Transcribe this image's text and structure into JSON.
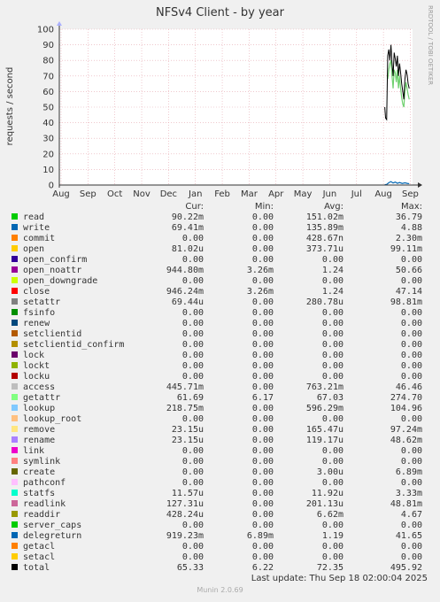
{
  "chart_data": {
    "type": "line",
    "title": "NFSv4 Client - by year",
    "ylabel": "requests / second",
    "side_label": "RRDTOOL / TOBI OETIKER",
    "ylim": [
      0,
      100
    ],
    "yticks": [
      0,
      10,
      20,
      30,
      40,
      50,
      60,
      70,
      80,
      90,
      100
    ],
    "x_categories": [
      "Aug",
      "Sep",
      "Oct",
      "Nov",
      "Dec",
      "Jan",
      "Feb",
      "Mar",
      "Apr",
      "May",
      "Jun",
      "Jul",
      "Aug",
      "Sep"
    ],
    "grid": true,
    "series_plot": [
      {
        "name": "total",
        "color": "#000000",
        "points": [
          [
            12.05,
            50
          ],
          [
            12.08,
            43
          ],
          [
            12.12,
            42
          ],
          [
            12.16,
            83
          ],
          [
            12.2,
            87
          ],
          [
            12.24,
            80
          ],
          [
            12.28,
            90
          ],
          [
            12.32,
            78
          ],
          [
            12.36,
            70
          ],
          [
            12.4,
            85
          ],
          [
            12.44,
            81
          ],
          [
            12.48,
            76
          ],
          [
            12.52,
            83
          ],
          [
            12.56,
            70
          ],
          [
            12.6,
            78
          ],
          [
            12.64,
            72
          ],
          [
            12.68,
            65
          ],
          [
            12.72,
            60
          ],
          [
            12.76,
            55
          ],
          [
            12.8,
            68
          ],
          [
            12.84,
            74
          ],
          [
            12.88,
            71
          ],
          [
            12.92,
            65
          ],
          [
            12.96,
            62
          ]
        ]
      },
      {
        "name": "access",
        "color": "#6fd06f",
        "points": [
          [
            12.16,
            68
          ],
          [
            12.2,
            74
          ],
          [
            12.24,
            78
          ],
          [
            12.28,
            80
          ],
          [
            12.32,
            70
          ],
          [
            12.36,
            62
          ],
          [
            12.4,
            74
          ],
          [
            12.44,
            72
          ],
          [
            12.48,
            66
          ],
          [
            12.52,
            74
          ],
          [
            12.56,
            62
          ],
          [
            12.6,
            70
          ],
          [
            12.64,
            62
          ],
          [
            12.68,
            56
          ],
          [
            12.72,
            52
          ],
          [
            12.76,
            50
          ],
          [
            12.8,
            60
          ],
          [
            12.84,
            66
          ],
          [
            12.88,
            62
          ],
          [
            12.92,
            58
          ],
          [
            12.96,
            55
          ]
        ]
      },
      {
        "name": "write",
        "color": "#0066b3",
        "points": [
          [
            12.05,
            0.2
          ],
          [
            12.12,
            0.4
          ],
          [
            12.2,
            1.5
          ],
          [
            12.28,
            2.2
          ],
          [
            12.36,
            1.3
          ],
          [
            12.44,
            1.9
          ],
          [
            12.52,
            1.1
          ],
          [
            12.6,
            1.6
          ],
          [
            12.7,
            1.0
          ],
          [
            12.8,
            1.4
          ],
          [
            12.9,
            1.0
          ],
          [
            12.96,
            0.9
          ]
        ]
      }
    ],
    "columns": [
      "Cur:",
      "Min:",
      "Avg:",
      "Max:"
    ],
    "series": [
      {
        "name": "read",
        "color": "#00cc00",
        "cur": "90.22m",
        "min": "0.00",
        "avg": "151.02m",
        "max": "36.79"
      },
      {
        "name": "write",
        "color": "#0066b3",
        "cur": "69.41m",
        "min": "0.00",
        "avg": "135.89m",
        "max": "4.88"
      },
      {
        "name": "commit",
        "color": "#ff8000",
        "cur": "0.00",
        "min": "0.00",
        "avg": "428.67n",
        "max": "2.30m"
      },
      {
        "name": "open",
        "color": "#ffcc00",
        "cur": "81.02u",
        "min": "0.00",
        "avg": "373.71u",
        "max": "99.11m"
      },
      {
        "name": "open_confirm",
        "color": "#330099",
        "cur": "0.00",
        "min": "0.00",
        "avg": "0.00",
        "max": "0.00"
      },
      {
        "name": "open_noattr",
        "color": "#990099",
        "cur": "944.80m",
        "min": "3.26m",
        "avg": "1.24",
        "max": "50.66"
      },
      {
        "name": "open_downgrade",
        "color": "#ccff00",
        "cur": "0.00",
        "min": "0.00",
        "avg": "0.00",
        "max": "0.00"
      },
      {
        "name": "close",
        "color": "#ff0000",
        "cur": "946.24m",
        "min": "3.26m",
        "avg": "1.24",
        "max": "47.14"
      },
      {
        "name": "setattr",
        "color": "#808080",
        "cur": "69.44u",
        "min": "0.00",
        "avg": "280.78u",
        "max": "98.81m"
      },
      {
        "name": "fsinfo",
        "color": "#008f00",
        "cur": "0.00",
        "min": "0.00",
        "avg": "0.00",
        "max": "0.00"
      },
      {
        "name": "renew",
        "color": "#00487d",
        "cur": "0.00",
        "min": "0.00",
        "avg": "0.00",
        "max": "0.00"
      },
      {
        "name": "setclientid",
        "color": "#b35a00",
        "cur": "0.00",
        "min": "0.00",
        "avg": "0.00",
        "max": "0.00"
      },
      {
        "name": "setclientid_confirm",
        "color": "#b38f00",
        "cur": "0.00",
        "min": "0.00",
        "avg": "0.00",
        "max": "0.00"
      },
      {
        "name": "lock",
        "color": "#6b006b",
        "cur": "0.00",
        "min": "0.00",
        "avg": "0.00",
        "max": "0.00"
      },
      {
        "name": "lockt",
        "color": "#8fb300",
        "cur": "0.00",
        "min": "0.00",
        "avg": "0.00",
        "max": "0.00"
      },
      {
        "name": "locku",
        "color": "#b30000",
        "cur": "0.00",
        "min": "0.00",
        "avg": "0.00",
        "max": "0.00"
      },
      {
        "name": "access",
        "color": "#bebebe",
        "cur": "445.71m",
        "min": "0.00",
        "avg": "763.21m",
        "max": "46.46"
      },
      {
        "name": "getattr",
        "color": "#80ff80",
        "cur": "61.69",
        "min": "6.17",
        "avg": "67.03",
        "max": "274.70"
      },
      {
        "name": "lookup",
        "color": "#80c9ff",
        "cur": "218.75m",
        "min": "0.00",
        "avg": "596.29m",
        "max": "104.96"
      },
      {
        "name": "lookup_root",
        "color": "#ffc080",
        "cur": "0.00",
        "min": "0.00",
        "avg": "0.00",
        "max": "0.00"
      },
      {
        "name": "remove",
        "color": "#ffe680",
        "cur": "23.15u",
        "min": "0.00",
        "avg": "165.47u",
        "max": "97.24m"
      },
      {
        "name": "rename",
        "color": "#aa80ff",
        "cur": "23.15u",
        "min": "0.00",
        "avg": "119.17u",
        "max": "48.62m"
      },
      {
        "name": "link",
        "color": "#ee00cc",
        "cur": "0.00",
        "min": "0.00",
        "avg": "0.00",
        "max": "0.00"
      },
      {
        "name": "symlink",
        "color": "#ff8080",
        "cur": "0.00",
        "min": "0.00",
        "avg": "0.00",
        "max": "0.00"
      },
      {
        "name": "create",
        "color": "#666600",
        "cur": "0.00",
        "min": "0.00",
        "avg": "3.00u",
        "max": "6.89m"
      },
      {
        "name": "pathconf",
        "color": "#ffbfff",
        "cur": "0.00",
        "min": "0.00",
        "avg": "0.00",
        "max": "0.00"
      },
      {
        "name": "statfs",
        "color": "#00ffcc",
        "cur": "11.57u",
        "min": "0.00",
        "avg": "11.92u",
        "max": "3.33m"
      },
      {
        "name": "readlink",
        "color": "#cc6699",
        "cur": "127.31u",
        "min": "0.00",
        "avg": "201.13u",
        "max": "48.81m"
      },
      {
        "name": "readdir",
        "color": "#999900",
        "cur": "428.24u",
        "min": "0.00",
        "avg": "6.62m",
        "max": "4.67"
      },
      {
        "name": "server_caps",
        "color": "#00cc00",
        "cur": "0.00",
        "min": "0.00",
        "avg": "0.00",
        "max": "0.00"
      },
      {
        "name": "delegreturn",
        "color": "#0066b3",
        "cur": "919.23m",
        "min": "6.89m",
        "avg": "1.19",
        "max": "41.65"
      },
      {
        "name": "getacl",
        "color": "#ff8000",
        "cur": "0.00",
        "min": "0.00",
        "avg": "0.00",
        "max": "0.00"
      },
      {
        "name": "setacl",
        "color": "#ffcc00",
        "cur": "0.00",
        "min": "0.00",
        "avg": "0.00",
        "max": "0.00"
      },
      {
        "name": "total",
        "color": "#000000",
        "cur": "65.33",
        "min": "6.22",
        "avg": "72.35",
        "max": "495.92"
      }
    ],
    "last_update": "Last update: Thu Sep 18 02:00:04 2025",
    "footer": "Munin 2.0.69"
  }
}
